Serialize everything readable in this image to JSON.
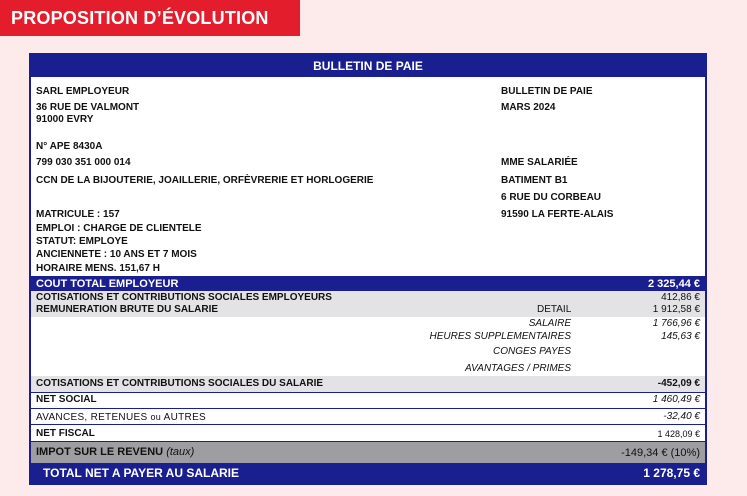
{
  "banner": "PROPOSITION D’ÉVOLUTION",
  "bulletin": {
    "title": "BULLETIN DE PAIE",
    "employer": {
      "name": "SARL EMPLOYEUR",
      "address1": "36 RUE DE VALMONT",
      "address2": "91000 EVRY",
      "ape": "N° APE 8430A",
      "siret": "799 030 351 000 014",
      "ccn": "CCN DE LA BIJOUTERIE, JOAILLERIE, ORFÈVRERIE ET HORLOGERIE"
    },
    "doc": {
      "label": "BULLETIN DE PAIE",
      "period": "MARS 2024"
    },
    "employee": {
      "name": "MME SALARIÉE",
      "building": "BATIMENT B1",
      "street": "6 RUE DU CORBEAU",
      "city": "91590 LA FERTE-ALAIS"
    },
    "info": {
      "matricule": "MATRICULE : 157",
      "emploi": "EMPLOI : CHARGE DE CLIENTELE",
      "statut": "STATUT: EMPLOYE",
      "anciennete": "ANCIENNETE : 10 ANS ET 7 MOIS",
      "horaire": "HORAIRE MENS. 151,67 H"
    },
    "rows": {
      "cout_total": {
        "label": "COUT TOTAL EMPLOYEUR",
        "value": "2 325,44 €"
      },
      "cotis_employeur": {
        "label": "COTISATIONS ET CONTRIBUTIONS SOCIALES EMPLOYEURS",
        "value": "412,86 €"
      },
      "remuneration": {
        "label": "REMUNERATION BRUTE DU SALARIE",
        "detail": "DETAIL",
        "value": "1 912,58 €"
      },
      "salaire": {
        "label": "SALAIRE",
        "value": "1 766,96 €"
      },
      "heures_sup": {
        "label": "HEURES SUPPLEMENTAIRES",
        "value": "145,63 €"
      },
      "conges": {
        "label": "CONGES PAYES"
      },
      "avantages": {
        "label": "AVANTAGES / PRIMES"
      },
      "cotis_salarie": {
        "label": "COTISATIONS ET CONTRIBUTIONS SOCIALES DU SALARIE",
        "value": "-452,09 €"
      },
      "net_social": {
        "label": "NET SOCIAL",
        "value": "1 460,49 €"
      },
      "avances": {
        "label_main": "AVANCES, RETENUES ",
        "label_ou": "ou",
        "label_end": " AUTRES",
        "value": "-32,40 €"
      },
      "net_fiscal": {
        "label": "NET FISCAL",
        "value": "1 428,09 €"
      },
      "impot": {
        "label": "IMPOT SUR LE REVENU ",
        "label_taux": "(taux)",
        "value": "-149,34 € (10%)"
      },
      "total_net": {
        "label": "TOTAL NET A PAYER AU SALARIE",
        "value": "1 278,75 €"
      }
    }
  }
}
